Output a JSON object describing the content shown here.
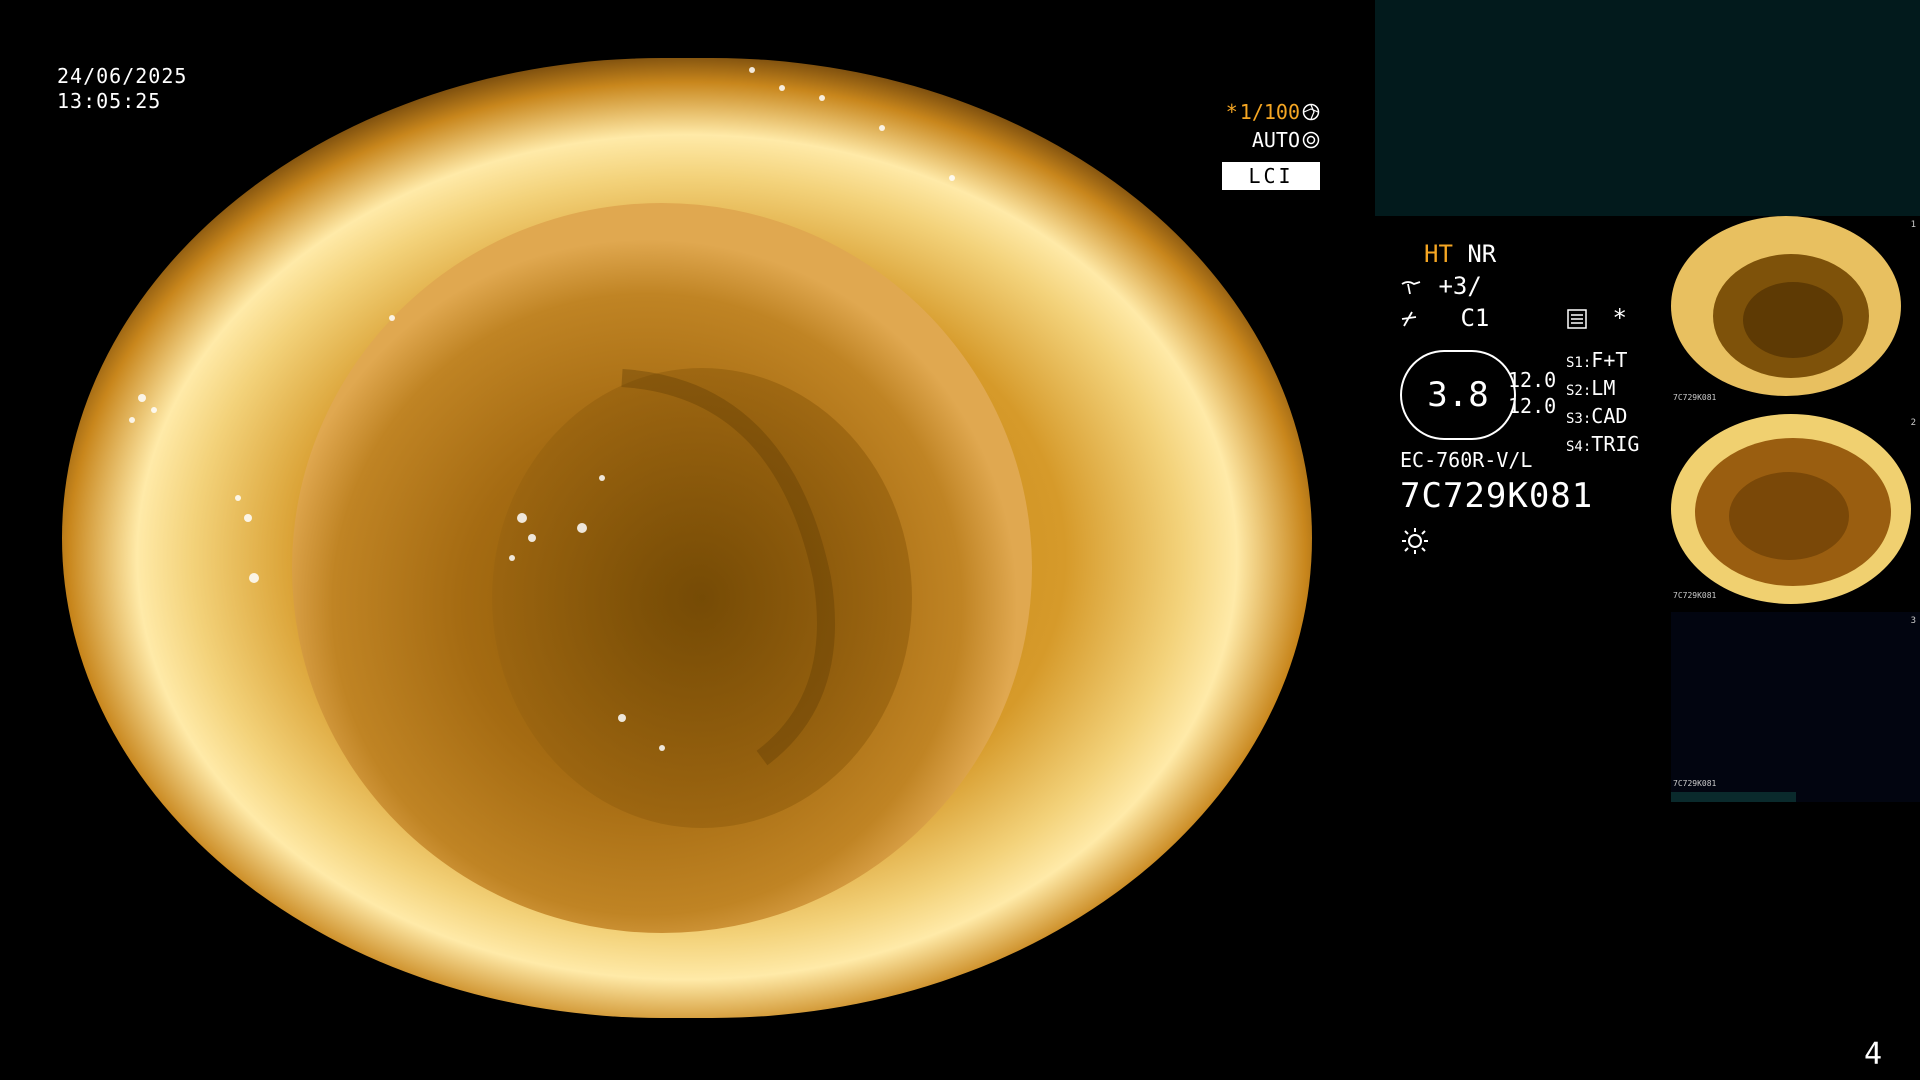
{
  "datetime": {
    "date": "24/06/2025",
    "time": "13:05:25"
  },
  "params": {
    "shutter_prefix": "*",
    "shutter": "1/100",
    "shutter_icon": "aperture-icon",
    "iris": "AUTO",
    "iris_icon": "iris-icon",
    "mode": "LCI"
  },
  "info": {
    "ht": "HT",
    "nr": "NR",
    "enhance_icon": "enhance-icon",
    "enhance": "+3/",
    "color_icon": "color-icon",
    "color": "C1",
    "menu_icon": "menu-icon",
    "star": "*",
    "gauge_value": "3.8",
    "range_top": "12.0",
    "range_bottom": "12.0",
    "presets": [
      {
        "key": "S1:",
        "value": "F+T"
      },
      {
        "key": "S2:",
        "value": "LM"
      },
      {
        "key": "S3:",
        "value": "CAD"
      },
      {
        "key": "S4:",
        "value": "TRIG"
      }
    ],
    "scope_model": "EC-760R-V/L",
    "serial": "7C729K081",
    "light_icon": "sun-icon"
  },
  "thumbnails": [
    {
      "label": "7C729K081",
      "num": "1"
    },
    {
      "label": "7C729K081",
      "num": "2"
    },
    {
      "label": "7C729K081",
      "num": "3"
    }
  ],
  "colors": {
    "accent": "#f5a623",
    "panel": "#021a1c"
  },
  "page_number": "4"
}
